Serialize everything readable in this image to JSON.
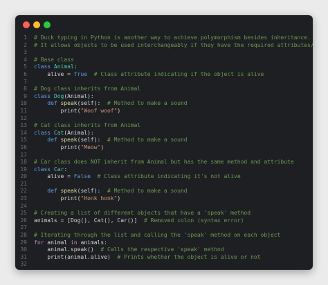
{
  "window": {
    "controls": [
      "close",
      "minimize",
      "maximize"
    ]
  },
  "code": {
    "lines": [
      {
        "n": "1",
        "tokens": [
          {
            "t": "# Duck typing in Python is another way to achieve polymorphism besides inheritance.",
            "c": "comment"
          }
        ]
      },
      {
        "n": "2",
        "tokens": [
          {
            "t": "# It allows objects to be used interchangeably if they have the required attributes/methods.",
            "c": "comment"
          }
        ]
      },
      {
        "n": "3",
        "tokens": []
      },
      {
        "n": "4",
        "tokens": [
          {
            "t": "# Base class",
            "c": "comment"
          }
        ]
      },
      {
        "n": "5",
        "tokens": [
          {
            "t": "class ",
            "c": "keyword"
          },
          {
            "t": "Animal",
            "c": "class"
          },
          {
            "t": ":",
            "c": "plain"
          }
        ]
      },
      {
        "n": "6",
        "tokens": [
          {
            "t": "    alive = ",
            "c": "plain"
          },
          {
            "t": "True",
            "c": "const"
          },
          {
            "t": "  ",
            "c": "plain"
          },
          {
            "t": "# Class attribute indicating if the object is alive",
            "c": "comment"
          }
        ]
      },
      {
        "n": "7",
        "tokens": []
      },
      {
        "n": "8",
        "tokens": [
          {
            "t": "# Dog class inherits from Animal",
            "c": "comment"
          }
        ]
      },
      {
        "n": "9",
        "tokens": [
          {
            "t": "class ",
            "c": "keyword"
          },
          {
            "t": "Dog",
            "c": "class"
          },
          {
            "t": "(Animal):",
            "c": "plain"
          }
        ]
      },
      {
        "n": "10",
        "tokens": [
          {
            "t": "    def ",
            "c": "keyword"
          },
          {
            "t": "speak",
            "c": "func"
          },
          {
            "t": "(self):  ",
            "c": "plain"
          },
          {
            "t": "# Method to make a sound",
            "c": "comment"
          }
        ]
      },
      {
        "n": "11",
        "tokens": [
          {
            "t": "        print(",
            "c": "plain"
          },
          {
            "t": "\"Woof woof\"",
            "c": "string"
          },
          {
            "t": ")",
            "c": "plain"
          }
        ]
      },
      {
        "n": "12",
        "tokens": []
      },
      {
        "n": "13",
        "tokens": [
          {
            "t": "# Cat class inherits from Animal",
            "c": "comment"
          }
        ]
      },
      {
        "n": "14",
        "tokens": [
          {
            "t": "class ",
            "c": "keyword"
          },
          {
            "t": "Cat",
            "c": "class"
          },
          {
            "t": "(Animal):",
            "c": "plain"
          }
        ]
      },
      {
        "n": "15",
        "tokens": [
          {
            "t": "    def ",
            "c": "keyword"
          },
          {
            "t": "speak",
            "c": "func"
          },
          {
            "t": "(self):  ",
            "c": "plain"
          },
          {
            "t": "# Method to make a sound",
            "c": "comment"
          }
        ]
      },
      {
        "n": "16",
        "tokens": [
          {
            "t": "        print(",
            "c": "plain"
          },
          {
            "t": "\"Meow\"",
            "c": "string"
          },
          {
            "t": ")",
            "c": "plain"
          }
        ]
      },
      {
        "n": "17",
        "tokens": []
      },
      {
        "n": "18",
        "tokens": [
          {
            "t": "# Car class does NOT inherit from Animal but has the same method and attribute",
            "c": "comment"
          }
        ]
      },
      {
        "n": "19",
        "tokens": [
          {
            "t": "class ",
            "c": "keyword"
          },
          {
            "t": "Car",
            "c": "class"
          },
          {
            "t": ":",
            "c": "plain"
          }
        ]
      },
      {
        "n": "20",
        "tokens": [
          {
            "t": "    alive = ",
            "c": "plain"
          },
          {
            "t": "False",
            "c": "const"
          },
          {
            "t": "  ",
            "c": "plain"
          },
          {
            "t": "# Class attribute indicating it's not alive",
            "c": "comment"
          }
        ]
      },
      {
        "n": "21",
        "tokens": []
      },
      {
        "n": "22",
        "tokens": [
          {
            "t": "    def ",
            "c": "keyword"
          },
          {
            "t": "speak",
            "c": "func"
          },
          {
            "t": "(self):  ",
            "c": "plain"
          },
          {
            "t": "# Method to make a sound",
            "c": "comment"
          }
        ]
      },
      {
        "n": "23",
        "tokens": [
          {
            "t": "        print(",
            "c": "plain"
          },
          {
            "t": "\"Honk honk\"",
            "c": "string"
          },
          {
            "t": ")",
            "c": "plain"
          }
        ]
      },
      {
        "n": "24",
        "tokens": []
      },
      {
        "n": "25",
        "tokens": [
          {
            "t": "# Creating a list of different objects that have a 'speak' method",
            "c": "comment"
          }
        ]
      },
      {
        "n": "26",
        "tokens": [
          {
            "t": "animals = [Dog(), Cat(), Car()]  ",
            "c": "plain"
          },
          {
            "t": "# Removed colon (syntax error)",
            "c": "comment"
          }
        ]
      },
      {
        "n": "27",
        "tokens": []
      },
      {
        "n": "28",
        "tokens": [
          {
            "t": "# Iterating through the list and calling the 'speak' method on each object",
            "c": "comment"
          }
        ]
      },
      {
        "n": "29",
        "tokens": [
          {
            "t": "for ",
            "c": "def"
          },
          {
            "t": "animal ",
            "c": "plain"
          },
          {
            "t": "in ",
            "c": "def"
          },
          {
            "t": "animals:",
            "c": "plain"
          }
        ]
      },
      {
        "n": "30",
        "tokens": [
          {
            "t": "    animal.speak()  ",
            "c": "plain"
          },
          {
            "t": "# Calls the respective 'speak' method",
            "c": "comment"
          }
        ]
      },
      {
        "n": "31",
        "tokens": [
          {
            "t": "    print(animal.alive)  ",
            "c": "plain"
          },
          {
            "t": "# Prints whether the object is alive or not",
            "c": "comment"
          }
        ]
      },
      {
        "n": "32",
        "tokens": []
      }
    ]
  },
  "colors": {
    "background": "#ebebeb",
    "window": "#1e1f22",
    "close": "#ff5f57",
    "minimize": "#febc2e",
    "maximize": "#28c840"
  }
}
